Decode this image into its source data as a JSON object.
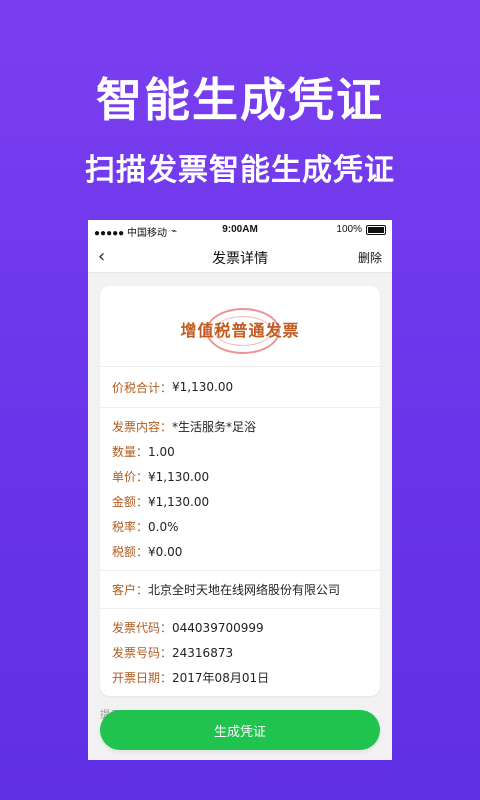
{
  "hero": {
    "title": "智能生成凭证",
    "subtitle": "扫描发票智能生成凭证"
  },
  "status": {
    "carrier": "●●●●● 中国移动",
    "time": "9:00AM",
    "battery": "100%"
  },
  "nav": {
    "title": "发票详情",
    "action": "删除"
  },
  "invoice": {
    "type": "增值税普通发票",
    "total_label": "价税合计：",
    "total_value": "¥1,130.00",
    "content_label": "发票内容：",
    "content_value": "*生活服务*足浴",
    "qty_label": "数量：",
    "qty_value": "1.00",
    "unit_label": "单价：",
    "unit_value": "¥1,130.00",
    "amount_label": "金额：",
    "amount_value": "¥1,130.00",
    "taxrate_label": "税率：",
    "taxrate_value": "0.0%",
    "tax_label": "税额：",
    "tax_value": "¥0.00",
    "customer_label": "客户：",
    "customer_value": "北京全时天地在线网络股份有限公司",
    "code_label": "发票代码：",
    "code_value": "044039700999",
    "number_label": "发票号码：",
    "number_value": "24316873",
    "date_label": "开票日期：",
    "date_value": "2017年08月01日"
  },
  "bottom": {
    "hint": "提示",
    "cta": "生成凭证"
  },
  "colors": {
    "bg": "#6a34ea",
    "cta": "#1fc34e",
    "label": "#b05c22"
  }
}
